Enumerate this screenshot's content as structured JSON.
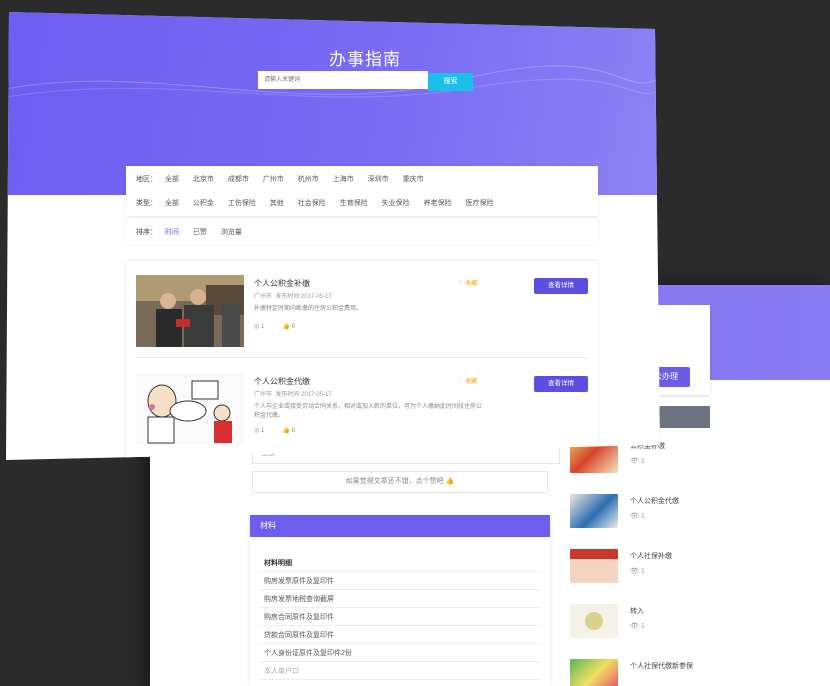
{
  "hero": {
    "title": "办事指南",
    "search_placeholder": "请输入关键词",
    "search_button": "搜索"
  },
  "filters": {
    "region_label": "地区：",
    "regions": [
      "全部",
      "北京市",
      "成都市",
      "广州市",
      "杭州市",
      "上海市",
      "深圳市",
      "重庆市"
    ],
    "type_label": "类型：",
    "types": [
      "全部",
      "公积金",
      "工伤保险",
      "其他",
      "社会保险",
      "生育保险",
      "失业保险",
      "养老保险",
      "医疗保险"
    ],
    "sort_label": "排序：",
    "sorts": [
      "时间",
      "已赞",
      "浏览量"
    ]
  },
  "list": [
    {
      "title": "个人公积金补缴",
      "city": "广州市",
      "date": "发布时间 2017-05-17",
      "desc": "补缴特定时期内断缴的住房公积金费用。",
      "views": "1",
      "likes": "0",
      "fav": "收藏",
      "button": "查看详情"
    },
    {
      "title": "个人公积金代缴",
      "city": "广州市",
      "date": "发布时间 2017-05-17",
      "desc": "个人与企业或接受劳动合同关系，相对或加入新的单位，可为个人缴纳此时间段住房公积金代缴。",
      "views": "1",
      "likes": "0",
      "fav": "收藏",
      "button": "查看详情"
    }
  ],
  "detail": {
    "button": "公办理",
    "gray_text": "全部",
    "tip": "如果觉得文章还不错，点个赞吧 👍",
    "materials_title": "材料",
    "materials": [
      "材料明细",
      "购房发票原件及复印件",
      "购房发票地税查询截屏",
      "购房合同原件及复印件",
      "贷款合同原件及复印件",
      "个人身份证原件及复印件2份",
      "本人单户口"
    ]
  },
  "sidebar": [
    {
      "title": "公积金补缴",
      "views": "1"
    },
    {
      "title": "个人公积金代缴",
      "views": "1"
    },
    {
      "title": "个人社保补缴",
      "views": "1"
    },
    {
      "title": "转入",
      "views": "1"
    },
    {
      "title": "个人社保代缴新参保",
      "views": "1"
    }
  ],
  "colors": {
    "accent": "#6c5ce7",
    "search_button": "#1bc0e8",
    "background": "#2b2b2b"
  }
}
